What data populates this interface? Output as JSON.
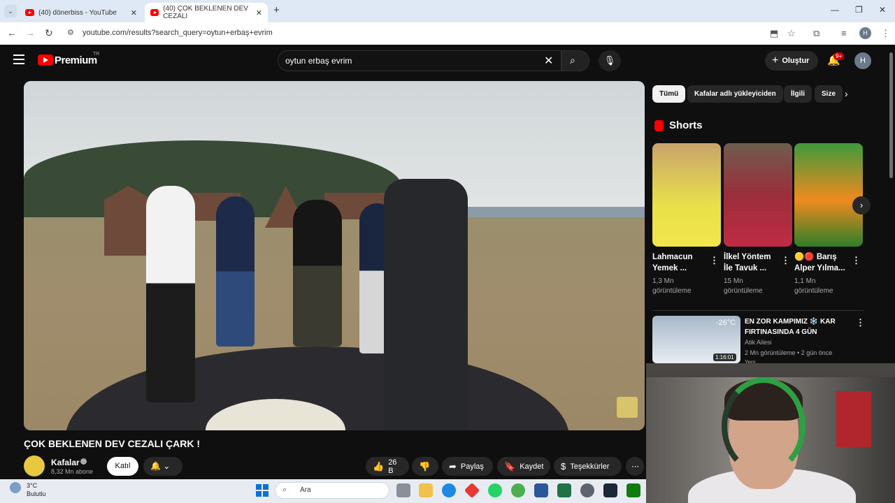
{
  "browser": {
    "tabs": [
      {
        "title": "(40) dönerbiss - YouTube"
      },
      {
        "title": "(40) ÇOK BEKLENEN DEV CEZALI"
      }
    ],
    "new_tab": "+",
    "url": "youtube.com/results?search_query=oytun+erbaş+evrim",
    "profile_initial": "H"
  },
  "youtube": {
    "brand": "Premium",
    "region": "TR",
    "search_value": "oytun erbaş evrim",
    "create_label": "Oluştur",
    "notification_count": "9+",
    "avatar_initial": "H"
  },
  "video": {
    "title": "ÇOK BEKLENEN DEV CEZALI ÇARK !",
    "channel": "Kafalar",
    "subscribers": "8,32 Mn abone",
    "join_label": "Katıl",
    "likes": "26 B",
    "share_label": "Paylaş",
    "save_label": "Kaydet",
    "thanks_label": "Teşekkürler"
  },
  "filters": [
    "Tümü",
    "Kafalar adlı yükleyiciden",
    "İlgili",
    "Size"
  ],
  "shorts": {
    "heading": "Shorts",
    "items": [
      {
        "title": "Lahmacun Yemek ...",
        "views": "1,3 Mn",
        "views_label": "görüntüleme"
      },
      {
        "title": "İlkel Yöntem İle Tavuk ...",
        "views": "15 Mn",
        "views_label": "görüntüleme"
      },
      {
        "title": "🟡🔴 Barış Alper Yılma...",
        "views": "1,1 Mn",
        "views_label": "görüntüleme"
      }
    ]
  },
  "recommended": {
    "title": "EN ZOR KAMPIMIZ ❄️ KAR FIRTINASINDA 4 GÜN",
    "channel": "Atik Ailesi",
    "meta": "2 Mn görüntüleme • 2 gün önce",
    "duration": "1:16:01",
    "thumb_text": "-26°C",
    "badge": "Yeni"
  },
  "taskbar": {
    "temperature": "3°C",
    "condition": "Bulutlu",
    "search_label": "Ara"
  },
  "colors": {
    "accent": "#ff0000",
    "background": "#0f0f0f"
  }
}
